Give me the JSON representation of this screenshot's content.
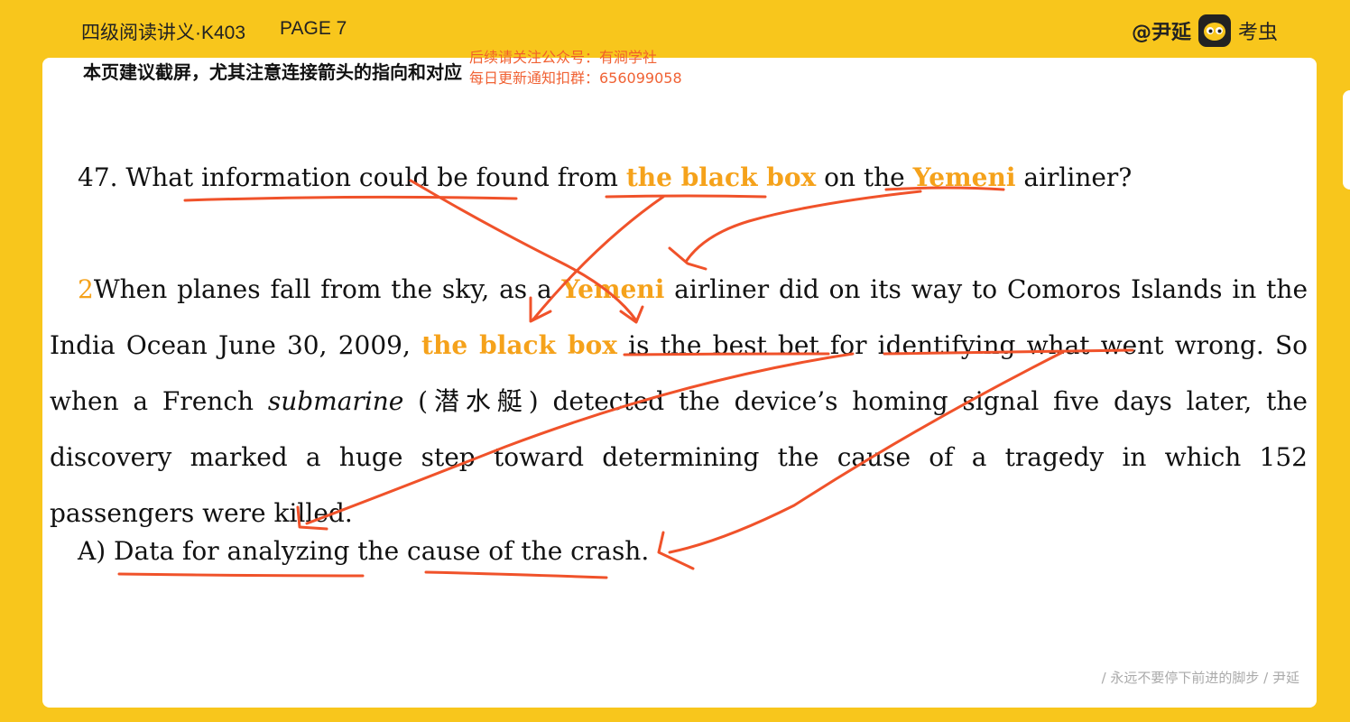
{
  "header": {
    "course": "四级阅读讲义·K403",
    "page": "PAGE 7",
    "brand_at": "@尹延",
    "brand_app": "考虫"
  },
  "note": "本页建议截屏，尤其注意连接箭头的指向和对应",
  "watermark": {
    "line1": "后续请关注公众号：有涧学社",
    "line2": "每日更新通知扣群：656099058"
  },
  "question": {
    "prefix": "47. What information could be found from ",
    "hl1": "the black box",
    "mid": " on the ",
    "hl2": "Yemeni",
    "suffix": " airliner?"
  },
  "paragraph": {
    "num": "2",
    "t1": "When planes fall from the sky, as a ",
    "hl1": "Yemeni",
    "t2": " airliner did on its way to Comoros Islands in the India Ocean June 30, 2009, ",
    "hl2": "the black box",
    "t3": " is the best bet for identifying what went wrong. So when a French ",
    "italic": "submarine",
    "t4": " (潜水艇) detected the device’s homing signal five days later, the discovery marked a huge step toward determining the cause of a tragedy in which 152 passengers were killed."
  },
  "option": "A) Data for analyzing the cause of the crash.",
  "footer": "/ 永远不要停下前进的脚步 /  尹延",
  "colors": {
    "background": "#F8C61C",
    "highlight": "#F5A21B",
    "annotation": "#F0522A"
  }
}
